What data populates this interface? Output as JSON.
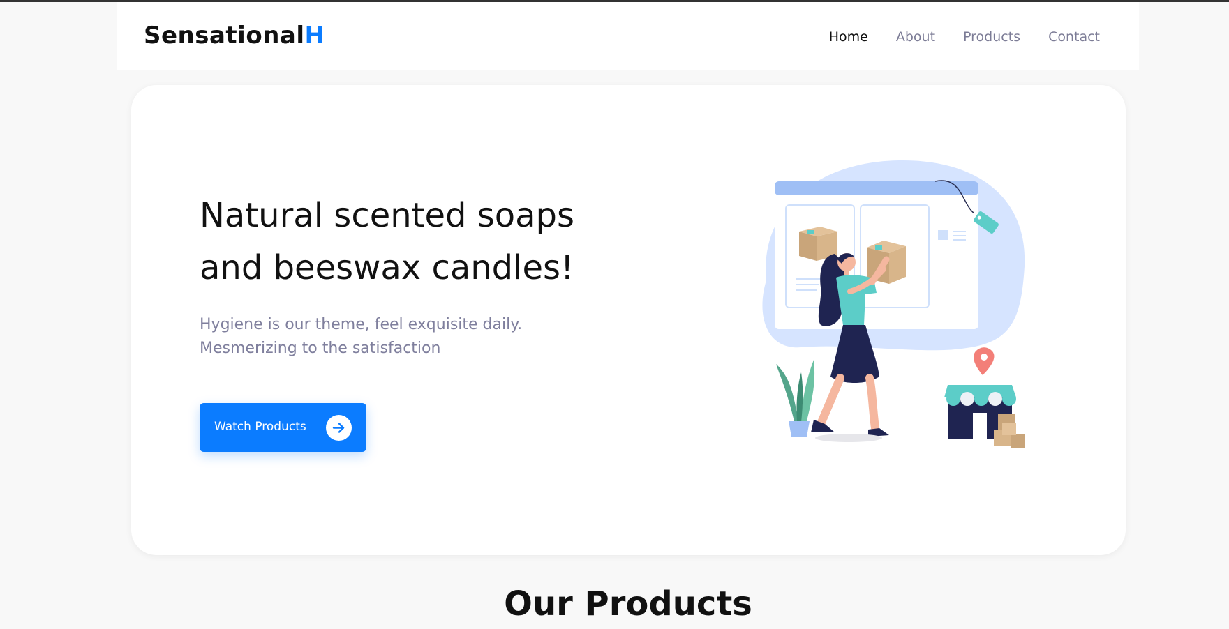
{
  "brand": {
    "name": "Sensational",
    "accent": "H"
  },
  "nav": {
    "items": [
      "Home",
      "About",
      "Products",
      "Contact"
    ],
    "active": "Home"
  },
  "hero": {
    "headline_line1": "Natural scented soaps",
    "headline_line2": "and beeswax candles!",
    "subtext_line1": "Hygiene is our theme, feel exquisite daily.",
    "subtext_line2": "Mesmerizing to the satisfaction",
    "cta_label": "Watch Products",
    "illustration": "shopping-woman-illustration"
  },
  "section": {
    "title": "Our Products"
  },
  "icons": {
    "cta": "arrow-right-icon"
  },
  "colors": {
    "accent": "#0b7cff",
    "background": "#f8f8f8",
    "muted_text": "#7f7f9d",
    "card": "#ffffff"
  }
}
